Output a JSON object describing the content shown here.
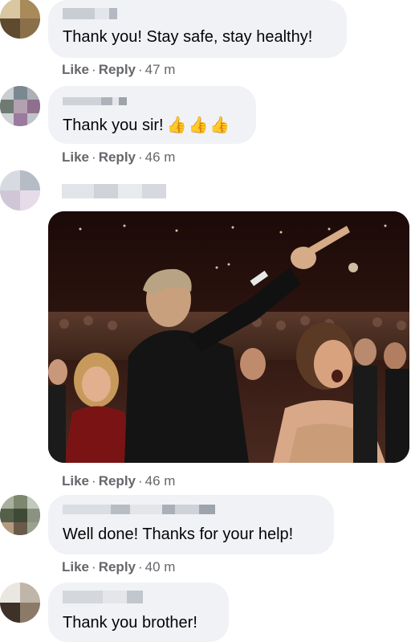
{
  "comments": [
    {
      "text": "Thank you! Stay safe, stay healthy!",
      "actions": {
        "like": "Like",
        "dot1": "·",
        "reply": "Reply",
        "dot2": "·",
        "time": "47 m"
      }
    },
    {
      "text": "Thank you sir!",
      "emoji": "👍👍👍",
      "actions": {
        "like": "Like",
        "dot1": "·",
        "reply": "Reply",
        "dot2": "·",
        "time": "46 m"
      }
    },
    {
      "actions": {
        "like": "Like",
        "dot1": "·",
        "reply": "Reply",
        "dot2": "·",
        "time": "46 m"
      }
    },
    {
      "text": "Well done! Thanks for your help!",
      "actions": {
        "like": "Like",
        "dot1": "·",
        "reply": "Reply",
        "dot2": "·",
        "time": "40 m"
      }
    },
    {
      "text": "Thank you brother!"
    }
  ],
  "colors": {
    "bubble": "#f0f2f5",
    "meta_text": "#65676b",
    "body_text": "#050505"
  }
}
